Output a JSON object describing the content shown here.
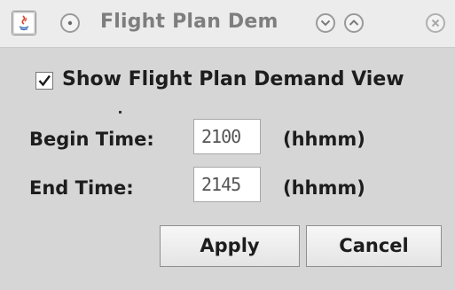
{
  "window": {
    "title": "Flight Plan Dem"
  },
  "form": {
    "show_label": "Show Flight Plan Demand View",
    "show_checked": true,
    "begin_label": "Begin Time:",
    "begin_value": "2100",
    "begin_unit": "(hhmm)",
    "end_label": "End Time:",
    "end_value": "2145",
    "end_unit": "(hhmm)"
  },
  "buttons": {
    "apply": "Apply",
    "cancel": "Cancel"
  },
  "icons": {
    "app": "java-app-icon",
    "menu": "window-menu-icon",
    "minimize": "minimize-icon",
    "maximize": "maximize-icon",
    "close": "close-icon"
  }
}
